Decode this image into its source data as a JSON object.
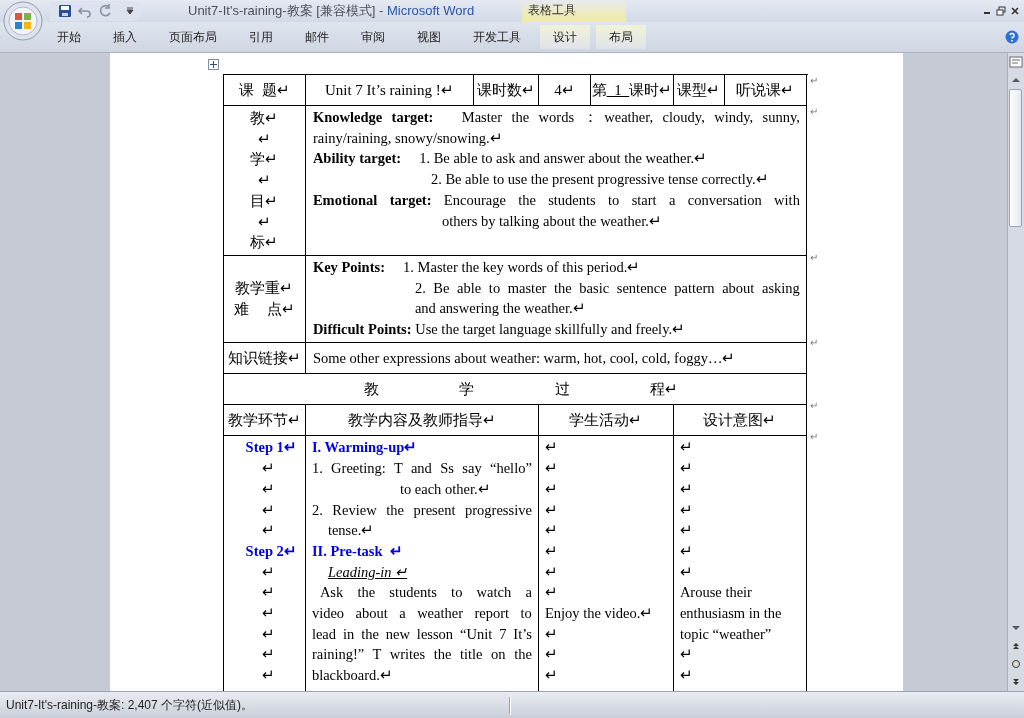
{
  "window": {
    "document_title": "Unit7-It's-raining-教案 [兼容模式] -",
    "app_name": "Microsoft Word",
    "contextual_group": "表格工具"
  },
  "ribbon_tabs": [
    {
      "label": "开始",
      "contextual": false
    },
    {
      "label": "插入",
      "contextual": false
    },
    {
      "label": "页面布局",
      "contextual": false
    },
    {
      "label": "引用",
      "contextual": false
    },
    {
      "label": "邮件",
      "contextual": false
    },
    {
      "label": "审阅",
      "contextual": false
    },
    {
      "label": "视图",
      "contextual": false
    },
    {
      "label": "开发工具",
      "contextual": false
    },
    {
      "label": "设计",
      "contextual": true
    },
    {
      "label": "布局",
      "contextual": true
    }
  ],
  "lesson_table": {
    "row_mark": "↵",
    "info_row": [
      {
        "parts": [
          {
            "text": "课  题↵",
            "underline": false
          }
        ]
      },
      {
        "parts": [
          {
            "text": "Unit 7 It’s raining !↵",
            "underline": false
          }
        ]
      },
      {
        "parts": [
          {
            "text": "课时数↵",
            "underline": false
          }
        ]
      },
      {
        "parts": [
          {
            "text": "4↵",
            "underline": false
          }
        ]
      },
      {
        "parts": [
          {
            "text": "第",
            "underline": false
          },
          {
            "text": "  1  ",
            "underline": true
          },
          {
            "text": "课时↵",
            "underline": false
          }
        ]
      },
      {
        "parts": [
          {
            "text": "课型↵",
            "underline": false
          }
        ]
      },
      {
        "parts": [
          {
            "text": "听说课↵",
            "underline": false
          }
        ]
      }
    ],
    "objectives": {
      "label_lines": [
        "教↵",
        "↵",
        "学↵",
        "↵",
        "目↵",
        "↵",
        "标↵"
      ],
      "lines": [
        {
          "text": "**Knowledge target:**   Master the words ：weather, cloudy, windy, sunny, rainy/raining, snowy/snowing.↵",
          "kind": "justify"
        },
        {
          "text": "**Ability target:**     1. Be able to ask and answer about the weather.↵",
          "kind": "plain"
        },
        {
          "text": "2. Be able to use the present progressive tense correctly.↵",
          "kind": "indent-wide"
        },
        {
          "text": "**Emotional target:** Encourage the students to start a conversation with",
          "kind": "full"
        },
        {
          "text": "others by talking about the weather.↵",
          "kind": "indent-widest"
        }
      ]
    },
    "key_points": {
      "label_lines": [
        "教学重↵",
        "难　 点↵"
      ],
      "lines": [
        {
          "text": "**Key Points:**     1. Master the key words of this period.↵",
          "kind": "plain"
        },
        {
          "text": "2. Be able to master the basic sentence pattern about asking",
          "kind": "indent-mid-full"
        },
        {
          "text": "and answering the weather.↵",
          "kind": "indent-mid"
        },
        {
          "text": "**Difficult Points:** Use the target language skillfully and freely.↵",
          "kind": "plain"
        }
      ]
    },
    "knowledge_link": {
      "label": "知识链接↵",
      "text": "Some other expressions about weather: warm, hot, cool, cold, foggy…↵"
    },
    "process_heading": [
      "教",
      "学",
      "过",
      "程↵"
    ],
    "process_columns": [
      "教学环节↵",
      "教学内容及教师指导↵",
      "学生活动↵",
      "设计意图↵"
    ],
    "process_body": [
      {
        "lines": [
          {
            "text": "Step 1↵",
            "kind": "step"
          },
          {
            "text": "↵",
            "kind": "mark"
          },
          {
            "text": "↵",
            "kind": "mark"
          },
          {
            "text": "↵",
            "kind": "mark"
          },
          {
            "text": "↵",
            "kind": "mark"
          },
          {
            "text": "Step 2↵",
            "kind": "step"
          },
          {
            "text": "↵",
            "kind": "mark"
          },
          {
            "text": "↵",
            "kind": "mark"
          },
          {
            "text": "↵",
            "kind": "mark"
          },
          {
            "text": "↵",
            "kind": "mark"
          },
          {
            "text": "↵",
            "kind": "mark"
          },
          {
            "text": "↵",
            "kind": "mark"
          }
        ]
      },
      {
        "lines": [
          {
            "text": "I. Warming-up↵",
            "kind": "heading"
          },
          {
            "text": "1. Greeting: T and Ss say “hello”",
            "kind": "full"
          },
          {
            "text": "to each other.↵",
            "kind": "indent-deep"
          },
          {
            "text": "2. Review the present progressive",
            "kind": "full"
          },
          {
            "text": "tense.↵",
            "kind": "indent"
          },
          {
            "text": "II. Pre-task  ↵",
            "kind": "heading"
          },
          {
            "text": "Leading-in ↵",
            "kind": "subheading"
          },
          {
            "text": "Ask the students to watch a",
            "kind": "indent-small-full"
          },
          {
            "text": "video about a weather report to",
            "kind": "full"
          },
          {
            "text": "lead in the new lesson “Unit 7 It’s",
            "kind": "full"
          },
          {
            "text": "raining!” T writes the title on the",
            "kind": "full"
          },
          {
            "text": "blackboard.↵",
            "kind": "plain"
          }
        ]
      },
      {
        "lines": [
          {
            "text": "↵",
            "kind": "plain"
          },
          {
            "text": "↵",
            "kind": "plain"
          },
          {
            "text": "↵",
            "kind": "plain"
          },
          {
            "text": "↵",
            "kind": "plain"
          },
          {
            "text": "↵",
            "kind": "plain"
          },
          {
            "text": "↵",
            "kind": "plain"
          },
          {
            "text": "↵",
            "kind": "plain"
          },
          {
            "text": "↵",
            "kind": "plain"
          },
          {
            "text": "Enjoy the video.↵",
            "kind": "plain"
          },
          {
            "text": "↵",
            "kind": "plain"
          },
          {
            "text": "↵",
            "kind": "plain"
          },
          {
            "text": "↵",
            "kind": "plain"
          }
        ]
      },
      {
        "lines": [
          {
            "text": "↵",
            "kind": "plain"
          },
          {
            "text": "↵",
            "kind": "plain"
          },
          {
            "text": "↵",
            "kind": "plain"
          },
          {
            "text": "↵",
            "kind": "plain"
          },
          {
            "text": "↵",
            "kind": "plain"
          },
          {
            "text": "↵",
            "kind": "plain"
          },
          {
            "text": "↵",
            "kind": "plain"
          },
          {
            "text": "Arouse their",
            "kind": "plain"
          },
          {
            "text": "enthusiasm in the",
            "kind": "plain"
          },
          {
            "text": "topic “weather”",
            "kind": "plain"
          },
          {
            "text": "↵",
            "kind": "plain"
          },
          {
            "text": "↵",
            "kind": "plain"
          }
        ]
      }
    ]
  },
  "status_bar": {
    "text": "Unit7-It's-raining-教案: 2,407 个字符(近似值)。"
  }
}
